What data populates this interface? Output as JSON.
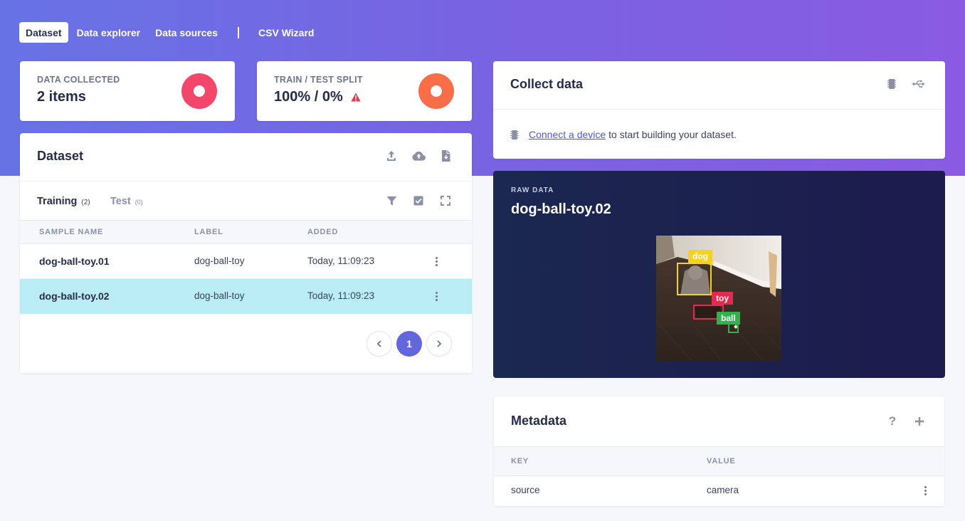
{
  "nav": {
    "tabs": [
      "Dataset",
      "Data explorer",
      "Data sources",
      "CSV Wizard"
    ]
  },
  "stats": {
    "collected": {
      "label": "DATA COLLECTED",
      "value": "2 items",
      "color": "#f2466b"
    },
    "split": {
      "label": "TRAIN / TEST SPLIT",
      "value": "100% / 0%",
      "color": "#f96d47",
      "warning_color": "#e5374c"
    }
  },
  "collect": {
    "title": "Collect data",
    "link_text": "Connect a device",
    "rest_text": " to start building your dataset."
  },
  "dataset": {
    "title": "Dataset",
    "tabs": {
      "training_label": "Training",
      "training_count": "(2)",
      "test_label": "Test",
      "test_count": "(0)"
    },
    "columns": [
      "SAMPLE NAME",
      "LABEL",
      "ADDED"
    ],
    "rows": [
      {
        "name": "dog-ball-toy.01",
        "label": "dog-ball-toy",
        "added": "Today, 11:09:23"
      },
      {
        "name": "dog-ball-toy.02",
        "label": "dog-ball-toy",
        "added": "Today, 11:09:23"
      }
    ],
    "selected_row": 1,
    "current_page": "1"
  },
  "raw": {
    "eyebrow": "RAW DATA",
    "title": "dog-ball-toy.02",
    "boxes": [
      {
        "label": "dog",
        "color": "#f5d21f"
      },
      {
        "label": "toy",
        "color": "#e8294f"
      },
      {
        "label": "ball",
        "color": "#2fb24c"
      }
    ]
  },
  "metadata": {
    "title": "Metadata",
    "columns": [
      "KEY",
      "VALUE"
    ],
    "rows": [
      {
        "key": "source",
        "value": "camera"
      }
    ]
  },
  "colors": {
    "accent": "#6466dd",
    "selected_row": "#b9ecf3",
    "header_gradient_start": "#6772e5",
    "header_gradient_end": "#8a5be2"
  }
}
